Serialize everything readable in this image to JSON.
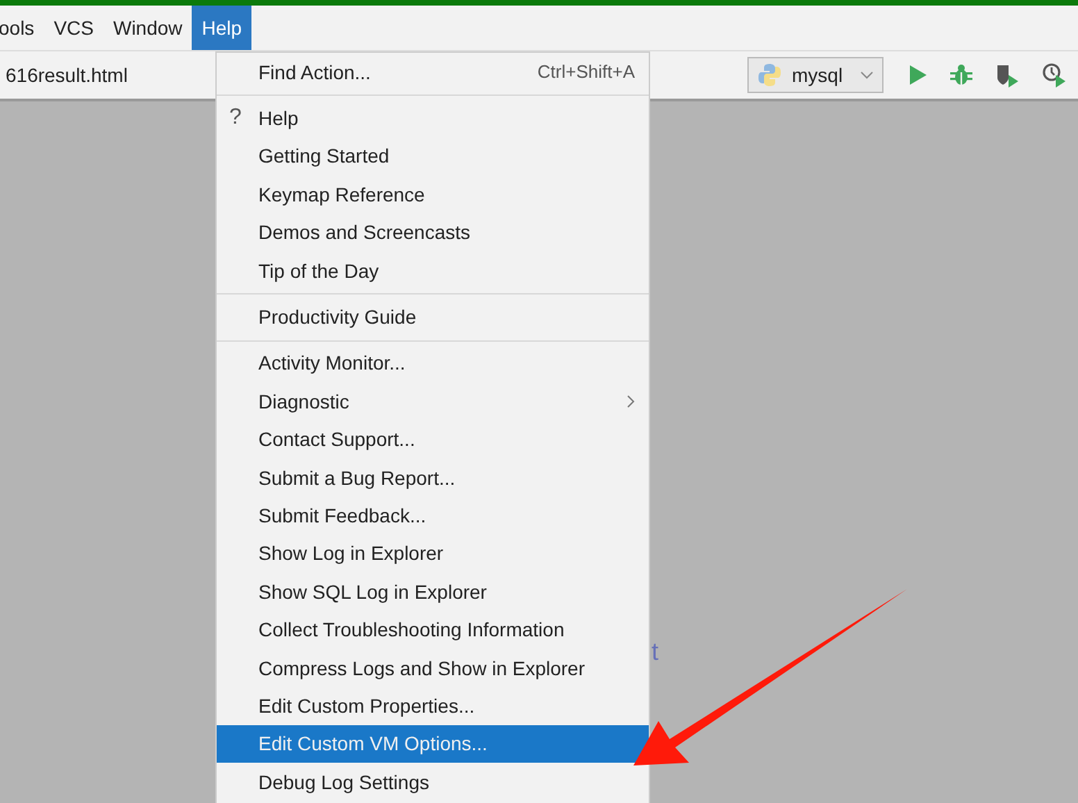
{
  "menu_bar": [
    {
      "label": "ools",
      "selected": false
    },
    {
      "label": "VCS",
      "selected": false
    },
    {
      "label": "Window",
      "selected": false
    },
    {
      "label": "Help",
      "selected": true
    }
  ],
  "tab": {
    "label": "616result.html"
  },
  "run_config": {
    "value": "mysql"
  },
  "background_text": "t",
  "help_menu": [
    [
      {
        "label": "Find Action...",
        "shortcut": "Ctrl+Shift+A",
        "has_submenu": false,
        "selected": false
      }
    ],
    [
      {
        "label": "Help",
        "icon": "?",
        "has_submenu": false,
        "selected": false
      },
      {
        "label": "Getting Started",
        "has_submenu": false,
        "selected": false
      },
      {
        "label": "Keymap Reference",
        "has_submenu": false,
        "selected": false
      },
      {
        "label": "Demos and Screencasts",
        "has_submenu": false,
        "selected": false
      },
      {
        "label": "Tip of the Day",
        "has_submenu": false,
        "selected": false
      }
    ],
    [
      {
        "label": "Productivity Guide",
        "has_submenu": false,
        "selected": false
      }
    ],
    [
      {
        "label": "Activity Monitor...",
        "has_submenu": false,
        "selected": false
      },
      {
        "label": "Diagnostic",
        "has_submenu": true,
        "selected": false
      },
      {
        "label": "Contact Support...",
        "has_submenu": false,
        "selected": false
      },
      {
        "label": "Submit a Bug Report...",
        "has_submenu": false,
        "selected": false
      },
      {
        "label": "Submit Feedback...",
        "has_submenu": false,
        "selected": false
      },
      {
        "label": "Show Log in Explorer",
        "has_submenu": false,
        "selected": false
      },
      {
        "label": "Show SQL Log in Explorer",
        "has_submenu": false,
        "selected": false
      },
      {
        "label": "Collect Troubleshooting Information",
        "has_submenu": false,
        "selected": false
      },
      {
        "label": "Compress Logs and Show in Explorer",
        "has_submenu": false,
        "selected": false
      },
      {
        "label": "Edit Custom Properties...",
        "has_submenu": false,
        "selected": false
      },
      {
        "label": "Edit Custom VM Options...",
        "has_submenu": false,
        "selected": true
      },
      {
        "label": "Debug Log Settings",
        "has_submenu": false,
        "selected": false
      }
    ]
  ]
}
